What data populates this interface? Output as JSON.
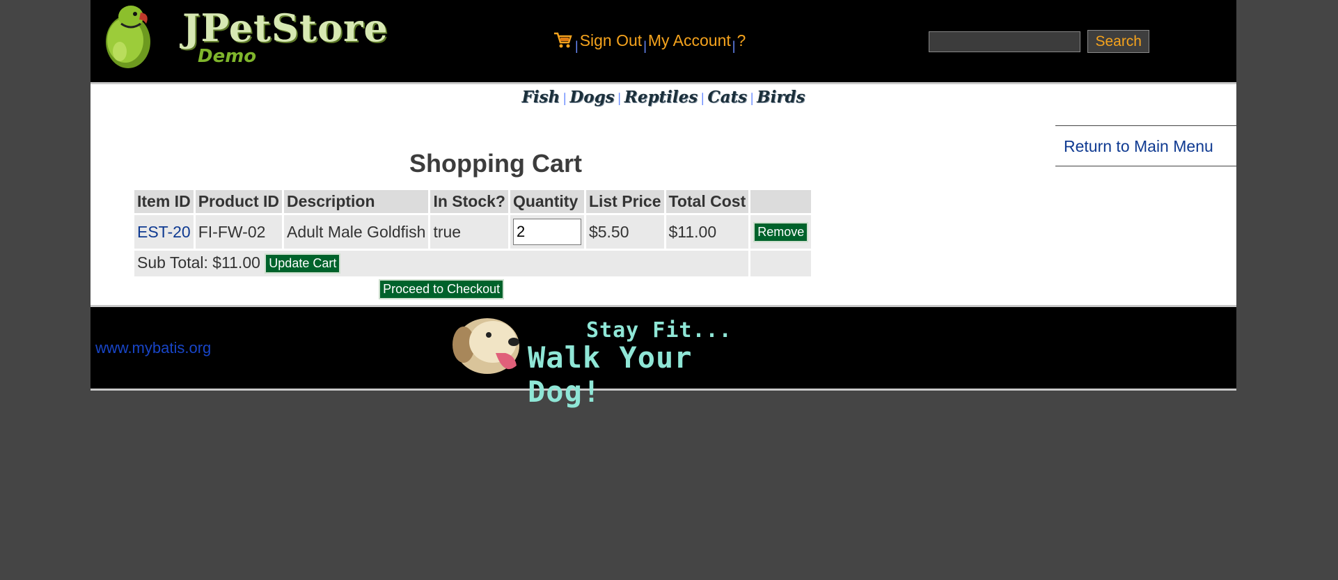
{
  "header": {
    "logo_title": "JPetStore",
    "logo_subtitle": "Demo",
    "menu": {
      "cart_icon": "shopping-cart-icon",
      "sign_out": "Sign Out",
      "my_account": "My Account",
      "help": "?",
      "separator": "|"
    },
    "search": {
      "value": "",
      "button_label": "Search"
    }
  },
  "quick_links": {
    "separator": "|",
    "items": [
      "Fish",
      "Dogs",
      "Reptiles",
      "Cats",
      "Birds"
    ]
  },
  "content": {
    "back_link": "Return to Main Menu",
    "title": "Shopping Cart",
    "table": {
      "headers": [
        "Item ID",
        "Product ID",
        "Description",
        "In Stock?",
        "Quantity",
        "List Price",
        "Total Cost"
      ],
      "rows": [
        {
          "item_id": "EST-20",
          "product_id": "FI-FW-02",
          "description": "Adult Male Goldfish",
          "in_stock": "true",
          "quantity": "2",
          "list_price": "$5.50",
          "total_cost": "$11.00",
          "remove_label": "Remove"
        }
      ],
      "subtotal": "Sub Total: $11.00",
      "update_label": "Update Cart",
      "checkout_label": "Proceed to Checkout"
    }
  },
  "footer": {
    "link": "www.mybatis.org",
    "banner_line1": "Stay Fit...",
    "banner_line2": "Walk Your Dog!"
  },
  "colors": {
    "page_bg": "#454545",
    "header_bg": "#000000",
    "menu_text": "#f5a31d",
    "link_blue": "#0f3a91",
    "button_green": "#00622b",
    "banner_text": "#8fe6d6"
  }
}
